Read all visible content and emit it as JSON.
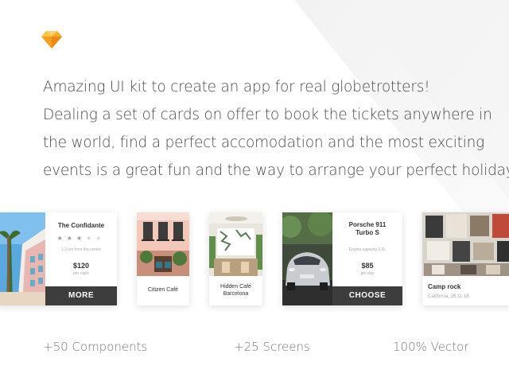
{
  "logo": {
    "icon": "sketch-diamond-icon",
    "color": "#f7a826"
  },
  "headline": {
    "lines": [
      "Amazing UI kit to create an app for real globetrotters!",
      "Dealing a set of cards on offer to book the tickets anywhere in",
      "the world, find a perfect accomodation and the most exciting",
      "events is a great fun and the way to arrange your perfect holiday."
    ]
  },
  "cards": {
    "hotel": {
      "title": "The Confidante",
      "stars": "★★★",
      "stars_off": "★★",
      "rating": 3,
      "distance": "1,2 km from the center",
      "price": "$120",
      "unit": "per night",
      "button": "MORE"
    },
    "cafe": {
      "caption": "Citizen Café"
    },
    "hidden": {
      "line1": "Hidden Café",
      "line2": "Barcelona"
    },
    "car": {
      "title_line1": "Porsche 911",
      "title_line2": "Turbo S",
      "spec": "Engine capacity 3.0L",
      "price": "$85",
      "unit": "per day",
      "button": "CHOOSE"
    },
    "event": {
      "title": "Camp rock",
      "subtitle": "California, 25.11.18"
    }
  },
  "footer": {
    "components": "+50 Components",
    "screens": "+25 Screens",
    "vector": "100% Vector"
  }
}
